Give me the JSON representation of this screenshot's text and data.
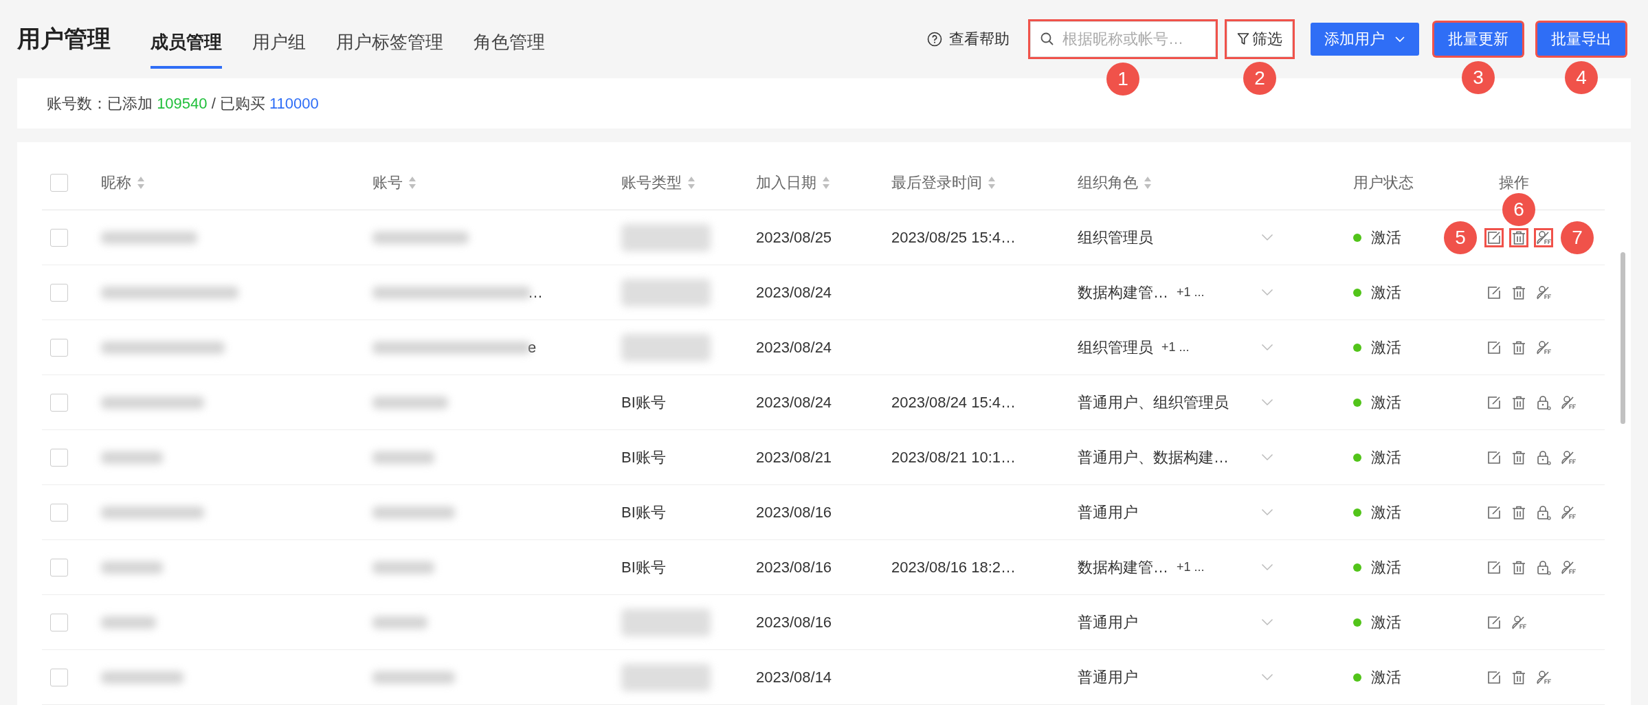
{
  "header": {
    "title": "用户管理",
    "tabs": [
      {
        "label": "成员管理",
        "selected": true
      },
      {
        "label": "用户组",
        "selected": false
      },
      {
        "label": "用户标签管理",
        "selected": false
      },
      {
        "label": "角色管理",
        "selected": false
      }
    ],
    "help": "查看帮助",
    "search": {
      "placeholder": "根据昵称或帐号…",
      "callout": "1"
    },
    "filter": {
      "label": "筛选",
      "callout": "2"
    },
    "buttons": [
      {
        "label": "添加用户",
        "kind": "dropdown"
      },
      {
        "label": "批量更新",
        "kind": "primary",
        "callout": "3"
      },
      {
        "label": "批量导出",
        "kind": "primary",
        "callout": "4"
      }
    ]
  },
  "summary": {
    "label": "账号数：已添加",
    "added": "109540",
    "separator": "/ 已购买",
    "purchased": "110000"
  },
  "table": {
    "columns": [
      {
        "label": "昵称",
        "sortable": true
      },
      {
        "label": "账号",
        "sortable": true
      },
      {
        "label": "账号类型",
        "sortable": true
      },
      {
        "label": "加入日期",
        "sortable": true
      },
      {
        "label": "最后登录时间",
        "sortable": true
      },
      {
        "label": "组织角色",
        "sortable": true
      },
      {
        "label": "用户状态",
        "sortable": false
      },
      {
        "label": "操作",
        "sortable": false
      }
    ],
    "select_all_checked": false,
    "rows": [
      {
        "checked": false,
        "account_type": null,
        "account_tail": null,
        "joined": "2023/08/25",
        "last_login": "2023/08/25 15:4…",
        "role": "组织管理员",
        "role_extra": null,
        "status": "激活",
        "color": "#52c41a",
        "actions": [
          {
            "kind": "edit",
            "callout": "5"
          },
          {
            "kind": "delete",
            "callout": "6"
          },
          {
            "kind": "disable",
            "callout": "7"
          }
        ]
      },
      {
        "checked": false,
        "account_type": null,
        "account_tail": "…",
        "joined": "2023/08/24",
        "last_login": null,
        "role": "数据构建管…",
        "role_extra": "+1 ...",
        "status": "激活",
        "color": "#52c41a",
        "actions": [
          {
            "kind": "edit"
          },
          {
            "kind": "delete"
          },
          {
            "kind": "disable"
          }
        ]
      },
      {
        "checked": false,
        "account_type": null,
        "account_tail": "e",
        "joined": "2023/08/24",
        "last_login": null,
        "role": "组织管理员",
        "role_extra": "+1 ...",
        "status": "激活",
        "color": "#52c41a",
        "actions": [
          {
            "kind": "edit"
          },
          {
            "kind": "delete"
          },
          {
            "kind": "disable"
          }
        ]
      },
      {
        "checked": false,
        "account_type": "BI账号",
        "account_tail": null,
        "joined": "2023/08/24",
        "last_login": "2023/08/24 15:4…",
        "role": "普通用户、组织管理员",
        "role_extra": null,
        "status": "激活",
        "color": "#52c41a",
        "actions": [
          {
            "kind": "edit"
          },
          {
            "kind": "delete"
          },
          {
            "kind": "lock"
          },
          {
            "kind": "disable"
          }
        ]
      },
      {
        "checked": false,
        "account_type": "BI账号",
        "account_tail": null,
        "joined": "2023/08/21",
        "last_login": "2023/08/21 10:1…",
        "role": "普通用户、数据构建…",
        "role_extra": null,
        "status": "激活",
        "color": "#52c41a",
        "actions": [
          {
            "kind": "edit"
          },
          {
            "kind": "delete"
          },
          {
            "kind": "lock"
          },
          {
            "kind": "disable"
          }
        ]
      },
      {
        "checked": false,
        "account_type": "BI账号",
        "account_tail": null,
        "joined": "2023/08/16",
        "last_login": null,
        "role": "普通用户",
        "role_extra": null,
        "status": "激活",
        "color": "#52c41a",
        "actions": [
          {
            "kind": "edit"
          },
          {
            "kind": "delete"
          },
          {
            "kind": "lock"
          },
          {
            "kind": "disable"
          }
        ]
      },
      {
        "checked": false,
        "account_type": "BI账号",
        "account_tail": null,
        "joined": "2023/08/16",
        "last_login": "2023/08/16 18:2…",
        "role": "数据构建管…",
        "role_extra": "+1 ...",
        "status": "激活",
        "color": "#52c41a",
        "actions": [
          {
            "kind": "edit"
          },
          {
            "kind": "delete"
          },
          {
            "kind": "lock"
          },
          {
            "kind": "disable"
          }
        ]
      },
      {
        "checked": false,
        "account_type": null,
        "account_tail": null,
        "joined": "2023/08/16",
        "last_login": null,
        "role": "普通用户",
        "role_extra": null,
        "status": "激活",
        "color": "#52c41a",
        "actions": [
          {
            "kind": "edit"
          },
          {
            "kind": "disable"
          }
        ]
      },
      {
        "checked": false,
        "account_type": null,
        "account_tail": null,
        "joined": "2023/08/14",
        "last_login": null,
        "role": "普通用户",
        "role_extra": null,
        "status": "激活",
        "color": "#52c41a",
        "actions": [
          {
            "kind": "edit"
          },
          {
            "kind": "delete"
          },
          {
            "kind": "disable"
          }
        ]
      }
    ]
  }
}
